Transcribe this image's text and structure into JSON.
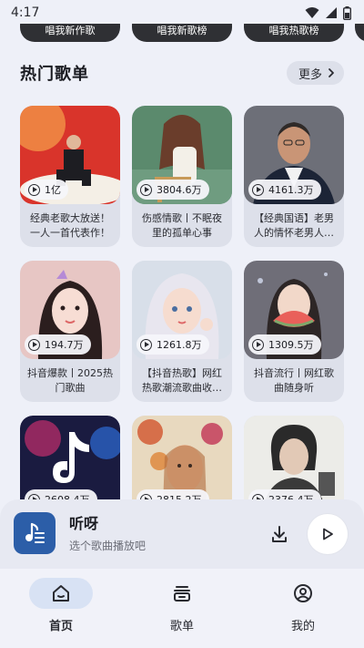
{
  "status_bar": {
    "time": "4:17"
  },
  "top_chips": [
    "唱我新作歌",
    "唱我新歌榜",
    "唱我热歌榜"
  ],
  "section": {
    "title": "热门歌单",
    "more_label": "更多"
  },
  "playlists": [
    {
      "plays": "1亿",
      "title": "经典老歌大放送！一人一首代表作！",
      "cover": "red-stage"
    },
    {
      "plays": "3804.6万",
      "title": "伤感情歌丨不眠夜里的孤单心事",
      "cover": "green-illustration"
    },
    {
      "plays": "4161.3万",
      "title": "【经典国语】老男人的情怀老男人…",
      "cover": "grey-portrait"
    },
    {
      "plays": "194.7万",
      "title": "抖音爆款丨2025热门歌曲",
      "cover": "pink-portrait"
    },
    {
      "plays": "1261.8万",
      "title": "【抖音热歌】网红热歌潮流歌曲收…",
      "cover": "blonde-portrait"
    },
    {
      "plays": "1309.5万",
      "title": "抖音流行丨网红歌曲随身听",
      "cover": "watermelon-portrait"
    },
    {
      "plays": "2608.4万",
      "title": "",
      "cover": "tiktok-logo"
    },
    {
      "plays": "2815.2万",
      "title": "",
      "cover": "flower-illustration"
    },
    {
      "plays": "2376.4万",
      "title": "",
      "cover": "bw-portrait"
    }
  ],
  "player": {
    "title": "听呀",
    "subtitle": "选个歌曲播放吧"
  },
  "nav": [
    {
      "label": "首页",
      "icon": "home-icon",
      "active": true
    },
    {
      "label": "歌单",
      "icon": "playlist-icon",
      "active": false
    },
    {
      "label": "我的",
      "icon": "profile-icon",
      "active": false
    }
  ],
  "colors": {
    "accent": "#2c5ea8",
    "background": "#eef0f8",
    "card": "#dde0ea",
    "active_nav": "#d8e2f4"
  }
}
